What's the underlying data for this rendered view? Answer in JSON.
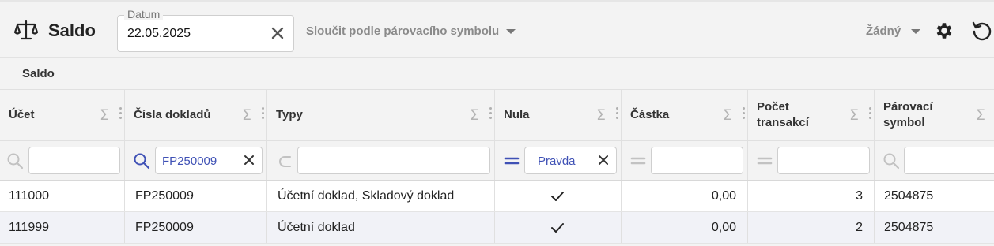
{
  "app": {
    "title": "Saldo",
    "icon": "scale-icon"
  },
  "toolbar": {
    "date_label": "Datum",
    "date_value": "22.05.2025",
    "merge_label": "Sloučit podle párovacího symbolu",
    "none_label": "Žádný"
  },
  "section": {
    "label": "Saldo"
  },
  "columns": [
    {
      "label_1": "Účet",
      "label_2": ""
    },
    {
      "label_1": "Čísla dokladů",
      "label_2": ""
    },
    {
      "label_1": "Typy",
      "label_2": ""
    },
    {
      "label_1": "Nula",
      "label_2": ""
    },
    {
      "label_1": "Částka",
      "label_2": ""
    },
    {
      "label_1": "Počet",
      "label_2": "transakcí"
    },
    {
      "label_1": "Párovací",
      "label_2": "symbol"
    }
  ],
  "sigma": "Σ",
  "filters": {
    "doc_numbers": "FP250009",
    "zero": "Pravda"
  },
  "rows": [
    {
      "account": "111000",
      "docs": "FP250009",
      "types": "Účetní doklad, Skladový doklad",
      "zero": true,
      "amount": "0,00",
      "count": "3",
      "symbol": "2504875"
    },
    {
      "account": "111999",
      "docs": "FP250009",
      "types": "Účetní doklad",
      "zero": true,
      "amount": "0,00",
      "count": "2",
      "symbol": "2504875"
    }
  ],
  "colors": {
    "accent": "#3f51b5",
    "row_alt": "#f1f2f7"
  }
}
